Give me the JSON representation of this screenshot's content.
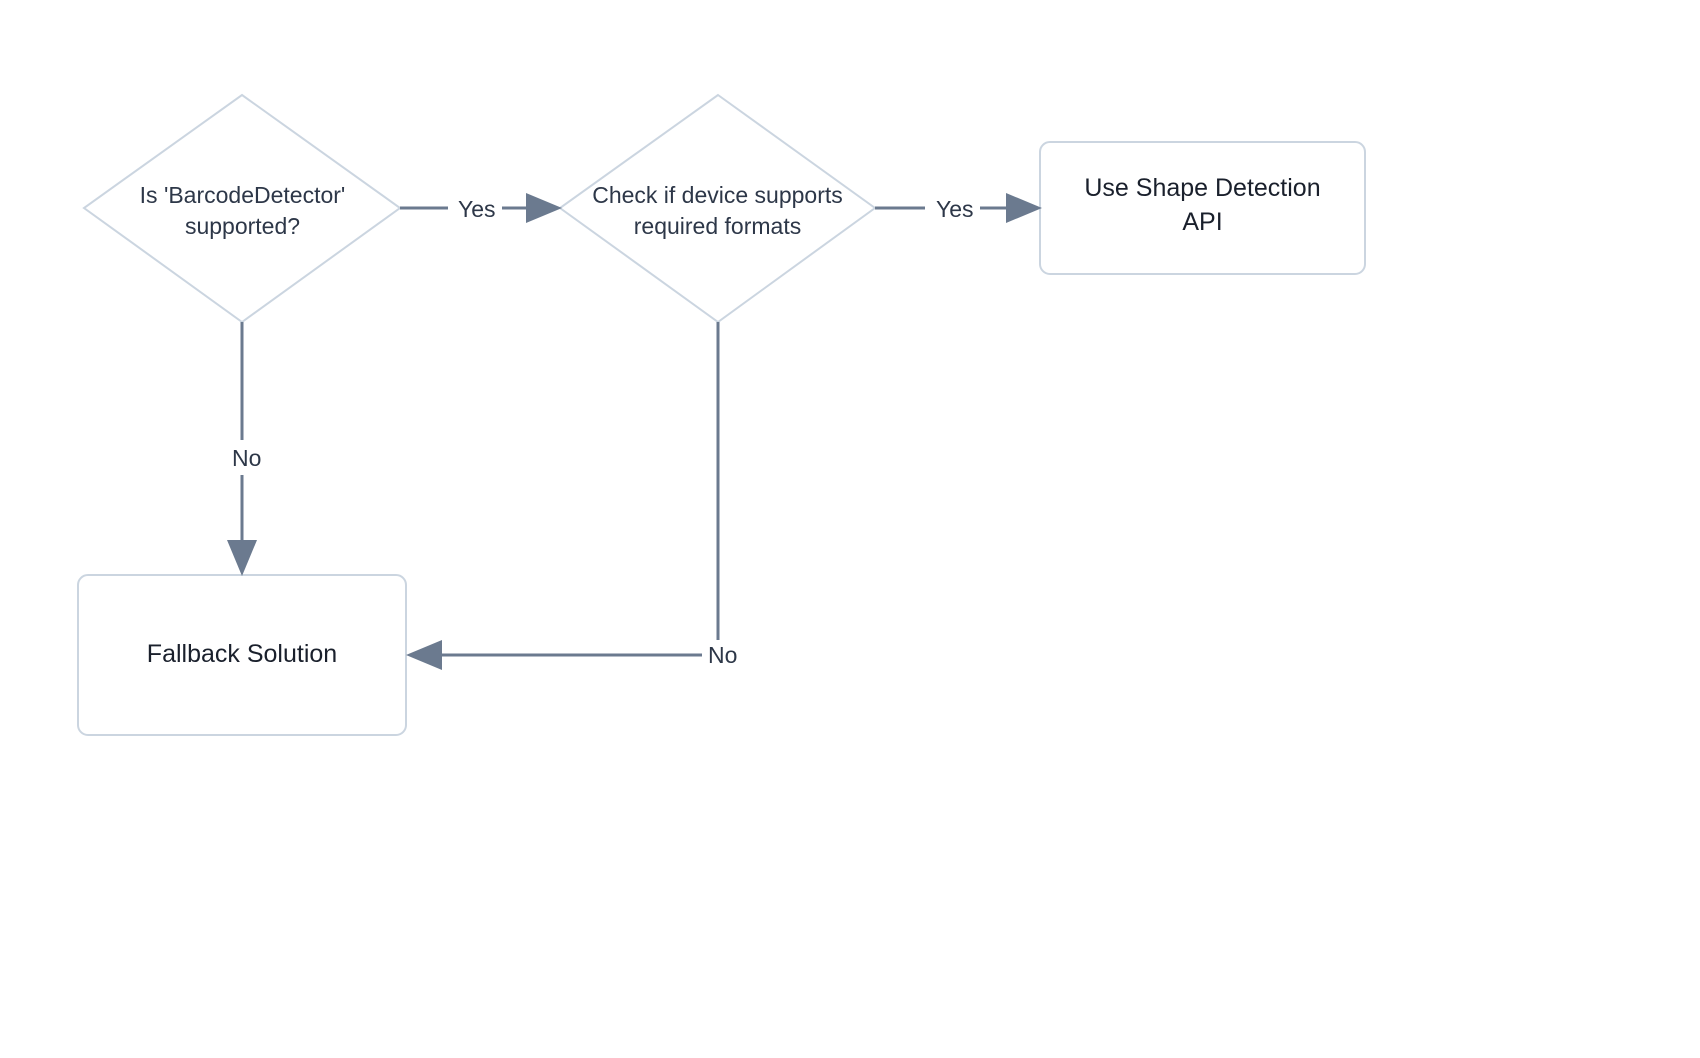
{
  "nodes": {
    "decision1": {
      "line1": "Is 'BarcodeDetector'",
      "line2": "supported?"
    },
    "decision2": {
      "line1": "Check if device supports",
      "line2": "required formats"
    },
    "process1": {
      "line1": "Use Shape Detection",
      "line2": "API"
    },
    "process2": {
      "line1": "Fallback Solution"
    }
  },
  "edges": {
    "d1_yes": "Yes",
    "d1_no": "No",
    "d2_yes": "Yes",
    "d2_no": "No"
  },
  "colors": {
    "shapeStroke": "#cbd5e0",
    "arrowStroke": "#6b7a8f"
  }
}
